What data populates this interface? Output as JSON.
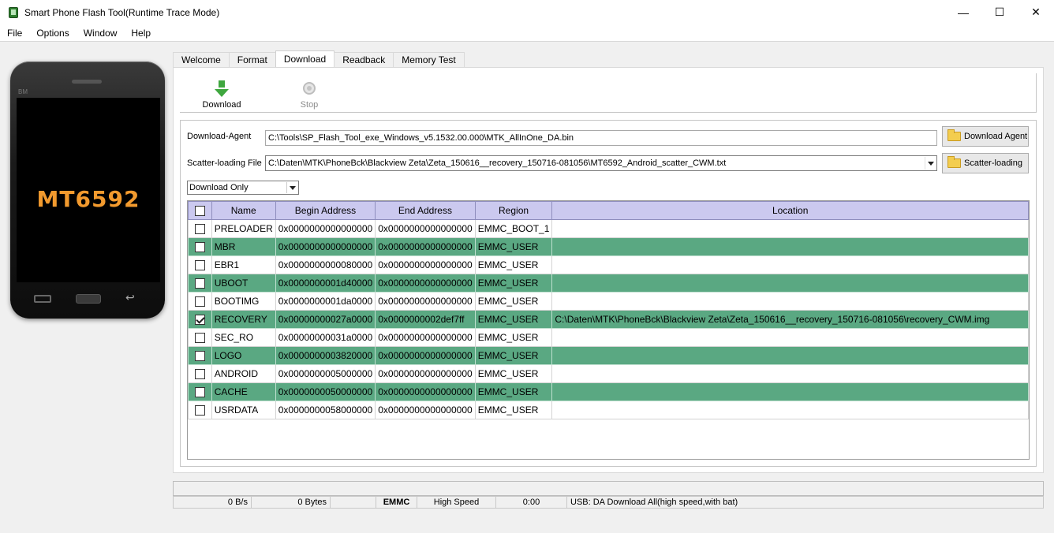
{
  "window": {
    "title": "Smart Phone Flash Tool(Runtime Trace Mode)",
    "controls": {
      "minimize": "—",
      "maximize": "☐",
      "close": "✕"
    }
  },
  "menu": [
    "File",
    "Options",
    "Window",
    "Help"
  ],
  "phone": {
    "brand": "BM",
    "chip": "MT6592"
  },
  "tabs": [
    "Welcome",
    "Format",
    "Download",
    "Readback",
    "Memory Test"
  ],
  "active_tab": "Download",
  "toolbar": {
    "download_label": "Download",
    "stop_label": "Stop"
  },
  "form": {
    "da_label": "Download-Agent",
    "da_value": "C:\\Tools\\SP_Flash_Tool_exe_Windows_v5.1532.00.000\\MTK_AllInOne_DA.bin",
    "da_button": "Download Agent",
    "scatter_label": "Scatter-loading File",
    "scatter_value": "C:\\Daten\\MTK\\PhoneBck\\Blackview Zeta\\Zeta_150616__recovery_150716-081056\\MT6592_Android_scatter_CWM.txt",
    "scatter_button": "Scatter-loading",
    "mode": "Download Only"
  },
  "table": {
    "headers": [
      "Name",
      "Begin Address",
      "End Address",
      "Region",
      "Location"
    ],
    "rows": [
      {
        "checked": false,
        "name": "PRELOADER",
        "begin": "0x0000000000000000",
        "end": "0x0000000000000000",
        "region": "EMMC_BOOT_1",
        "location": ""
      },
      {
        "checked": false,
        "name": "MBR",
        "begin": "0x0000000000000000",
        "end": "0x0000000000000000",
        "region": "EMMC_USER",
        "location": ""
      },
      {
        "checked": false,
        "name": "EBR1",
        "begin": "0x0000000000080000",
        "end": "0x0000000000000000",
        "region": "EMMC_USER",
        "location": ""
      },
      {
        "checked": false,
        "name": "UBOOT",
        "begin": "0x0000000001d40000",
        "end": "0x0000000000000000",
        "region": "EMMC_USER",
        "location": ""
      },
      {
        "checked": false,
        "name": "BOOTIMG",
        "begin": "0x0000000001da0000",
        "end": "0x0000000000000000",
        "region": "EMMC_USER",
        "location": ""
      },
      {
        "checked": true,
        "name": "RECOVERY",
        "begin": "0x00000000027a0000",
        "end": "0x0000000002def7ff",
        "region": "EMMC_USER",
        "location": "C:\\Daten\\MTK\\PhoneBck\\Blackview Zeta\\Zeta_150616__recovery_150716-081056\\recovery_CWM.img"
      },
      {
        "checked": false,
        "name": "SEC_RO",
        "begin": "0x00000000031a0000",
        "end": "0x0000000000000000",
        "region": "EMMC_USER",
        "location": ""
      },
      {
        "checked": false,
        "name": "LOGO",
        "begin": "0x0000000003820000",
        "end": "0x0000000000000000",
        "region": "EMMC_USER",
        "location": ""
      },
      {
        "checked": false,
        "name": "ANDROID",
        "begin": "0x0000000005000000",
        "end": "0x0000000000000000",
        "region": "EMMC_USER",
        "location": ""
      },
      {
        "checked": false,
        "name": "CACHE",
        "begin": "0x0000000050000000",
        "end": "0x0000000000000000",
        "region": "EMMC_USER",
        "location": ""
      },
      {
        "checked": false,
        "name": "USRDATA",
        "begin": "0x0000000058000000",
        "end": "0x0000000000000000",
        "region": "EMMC_USER",
        "location": ""
      }
    ]
  },
  "status": {
    "speed": "0 B/s",
    "bytes": "0 Bytes",
    "storage": "EMMC",
    "usb_speed": "High Speed",
    "time": "0:00",
    "message": "USB: DA Download All(high speed,with bat)"
  },
  "colors": {
    "row_highlight": "#5aa882",
    "header_bg": "#cbc9ef",
    "chip_text": "#f29a2e",
    "download_arrow": "#3fa73f"
  }
}
